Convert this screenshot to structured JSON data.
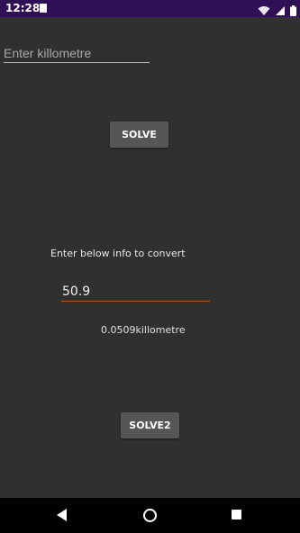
{
  "status_bar": {
    "time": "12:28",
    "icons": [
      "sim-card-icon",
      "wifi-icon",
      "signal-icon",
      "battery-icon"
    ]
  },
  "kilometre_input": {
    "placeholder": "Enter killometre",
    "value": ""
  },
  "solve_button": {
    "label": "SOLVE"
  },
  "instruction_text": "Enter below info to convert",
  "value_input": {
    "value": "50.9"
  },
  "result_text": "0.0509killometre",
  "solve2_button": {
    "label": "SOLVE2"
  },
  "navigation": {
    "icons": [
      "back-icon",
      "home-icon",
      "recents-icon"
    ]
  },
  "colors": {
    "status_bar": "#2f0f55",
    "background": "#303030",
    "button": "#565656",
    "input_underline_active": "#b35b1d",
    "nav_bar": "#000000"
  }
}
